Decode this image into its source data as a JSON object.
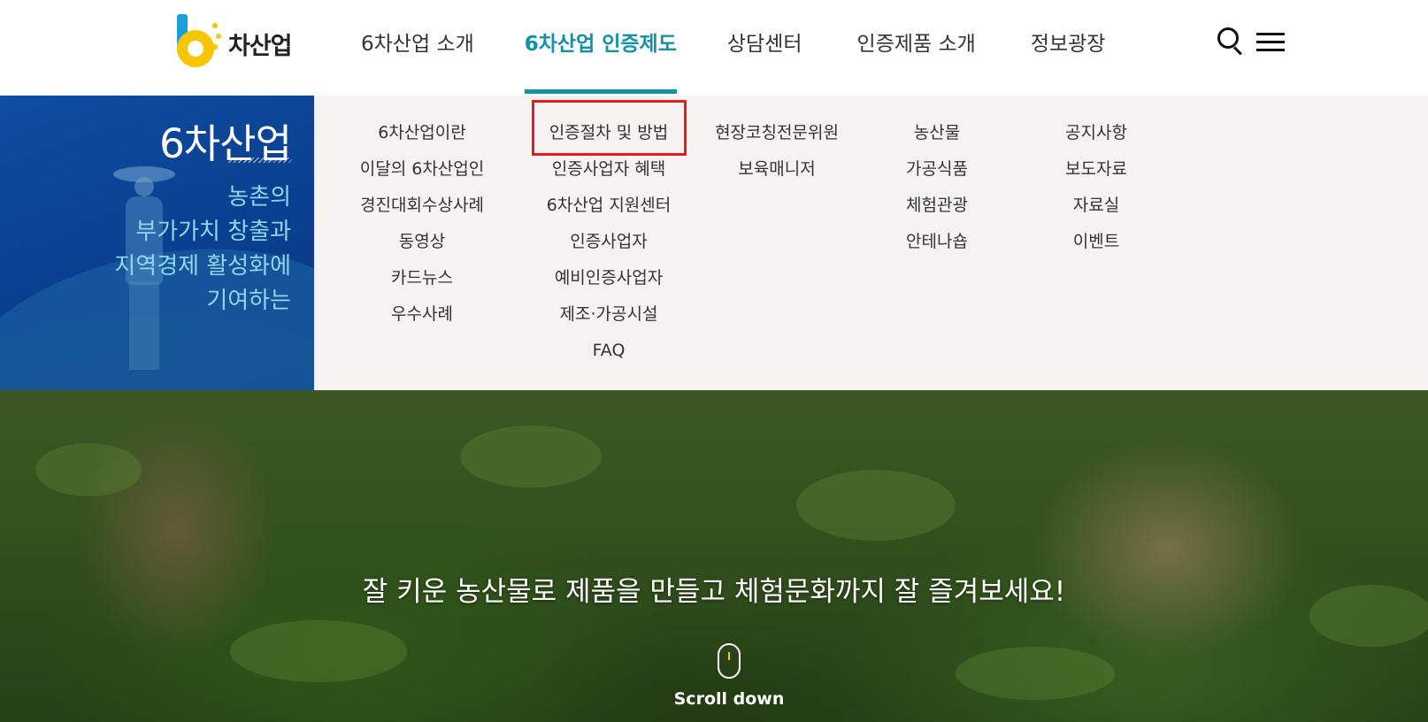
{
  "header": {
    "logo_text": "차산업",
    "nav": [
      {
        "label": "6차산업 소개",
        "active": false
      },
      {
        "label": "6차산업 인증제도",
        "active": true
      },
      {
        "label": "상담센터",
        "active": false
      },
      {
        "label": "인증제품 소개",
        "active": false
      },
      {
        "label": "정보광장",
        "active": false
      }
    ],
    "icons": {
      "search": "search-icon",
      "menu": "hamburger-menu-icon"
    }
  },
  "promo": {
    "title": "6차산업",
    "lines": [
      "농촌의",
      "부가가치 창출과",
      "지역경제 활성화에",
      "기여하는"
    ]
  },
  "menu": {
    "col1": [
      "6차산업이란",
      "이달의 6차산업인",
      "경진대회수상사례",
      "동영상",
      "카드뉴스",
      "우수사례"
    ],
    "col2": [
      "인증절차 및 방법",
      "인증사업자 혜택",
      "6차산업 지원센터",
      "인증사업자",
      "예비인증사업자",
      "제조·가공시설",
      "FAQ"
    ],
    "col3": [
      "현장코칭전문위원",
      "보육매니저"
    ],
    "col4": [
      "농산물",
      "가공식품",
      "체험관광",
      "안테나숍"
    ],
    "col5": [
      "공지사항",
      "보도자료",
      "자료실",
      "이벤트"
    ],
    "highlighted": "인증절차 및 방법"
  },
  "hero": {
    "tagline": "잘 키운 농산물로 제품을 만들고 체험문화까지 잘 즐겨보세요!",
    "scroll_label": "Scroll down"
  },
  "colors": {
    "accent": "#1591a7",
    "promo_bg": "#0f4da0",
    "highlight_box": "#e41c22",
    "logo_yellow": "#f7c600",
    "logo_blue": "#1a9fd6"
  }
}
